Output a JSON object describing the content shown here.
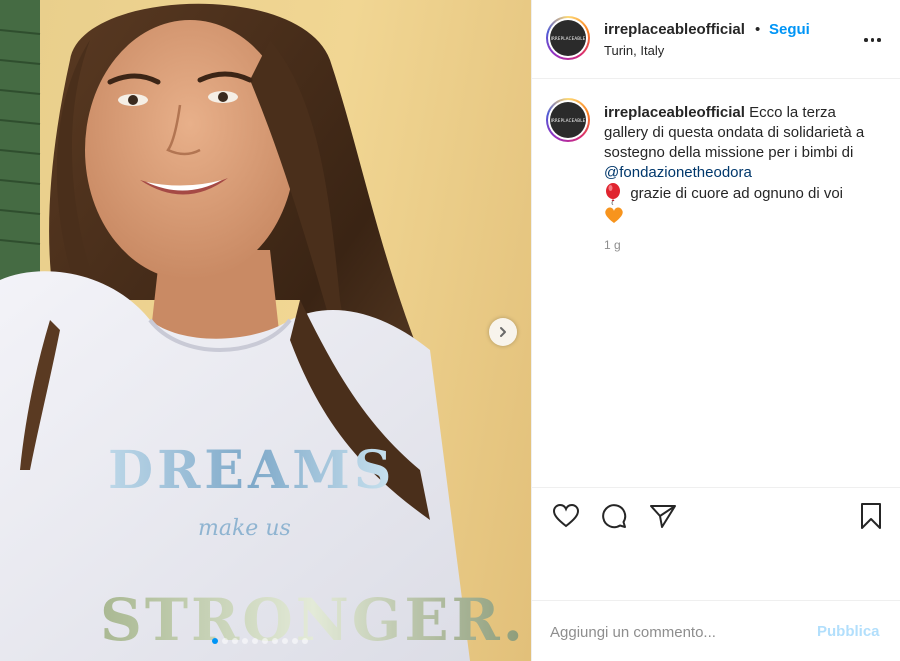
{
  "post": {
    "image": {
      "shirt_text_main": "DREAMS",
      "shirt_text_small": "make us",
      "shirt_text_bottom": "STRONGER.",
      "carousel_dot_count": 10,
      "active_dot_index": 0
    },
    "header": {
      "avatar_text": "IRREPLACEABLE",
      "username": "irreplaceableofficial",
      "bullet": "•",
      "follow_label": "Segui",
      "location": "Turin, Italy"
    },
    "caption": {
      "avatar_text": "IRREPLACEABLE",
      "username": "irreplaceableofficial",
      "text_before_mention": "Ecco la terza gallery di questa ondata di solidarietà a sostegno della missione per i bimbi di",
      "mention": "@fondazionetheodora",
      "text_after_mention": "grazie di cuore ad ognuno di voi",
      "emoji_1": "balloon-icon",
      "emoji_2": "orange-heart-icon",
      "time_ago": "1 g"
    },
    "actions": {
      "like": "heart-icon",
      "comment": "comment-icon",
      "share": "paper-plane-icon",
      "save": "bookmark-icon"
    },
    "comment_box": {
      "placeholder": "Aggiungi un commento...",
      "publish_label": "Pubblica"
    },
    "colors": {
      "accent": "#0095f6",
      "mention": "#00376b",
      "publish_disabled": "#b2dffc",
      "muted_text": "#8e8e8e"
    }
  }
}
